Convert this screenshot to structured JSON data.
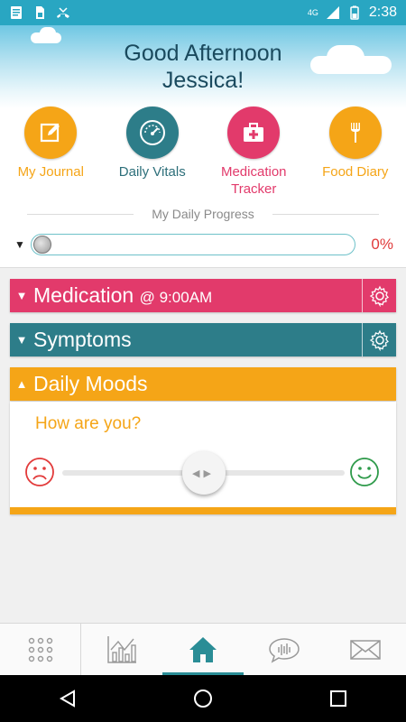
{
  "status_bar": {
    "network": "4G",
    "time": "2:38",
    "icons": [
      "notes-icon",
      "sim-card-icon",
      "missed-call-icon",
      "signal-icon",
      "battery-icon"
    ]
  },
  "header": {
    "greeting_line1": "Good Afternoon",
    "greeting_line2": "Jessica!"
  },
  "features": [
    {
      "label": "My Journal",
      "icon": "journal-edit-icon",
      "color": "#f5a517",
      "text_color": "#f5a517"
    },
    {
      "label": "Daily Vitals",
      "icon": "gauge-icon",
      "color": "#2d7d89",
      "text_color": "#2d6f7a"
    },
    {
      "label": "Medication\nTracker",
      "icon": "medkit-icon",
      "color": "#e23a6b",
      "text_color": "#e23a6b"
    },
    {
      "label": "Food Diary",
      "icon": "fork-icon",
      "color": "#f5a517",
      "text_color": "#f5a517"
    }
  ],
  "progress": {
    "title": "My Daily Progress",
    "value": 0,
    "percent_label": "0%"
  },
  "sections": {
    "medication": {
      "title": "Medication",
      "time": "@ 9:00AM",
      "color": "#e23a6b",
      "expanded": false
    },
    "symptoms": {
      "title": "Symptoms",
      "color": "#2d7d89",
      "expanded": false
    },
    "moods": {
      "title": "Daily Moods",
      "color": "#f5a517",
      "expanded": true,
      "question": "How are you?",
      "slider_value": 0.5
    }
  },
  "tabs": [
    {
      "name": "apps-grid",
      "icon": "grid-icon",
      "active": false
    },
    {
      "name": "charts",
      "icon": "chart-icon",
      "active": false
    },
    {
      "name": "home",
      "icon": "home-icon",
      "active": true
    },
    {
      "name": "messages",
      "icon": "chat-icon",
      "active": false
    },
    {
      "name": "mail",
      "icon": "mail-icon",
      "active": false
    }
  ],
  "colors": {
    "accent_teal": "#2a8d96",
    "accent_pink": "#e23a6b",
    "accent_orange": "#f5a517",
    "status_bar": "#29a6c2"
  }
}
